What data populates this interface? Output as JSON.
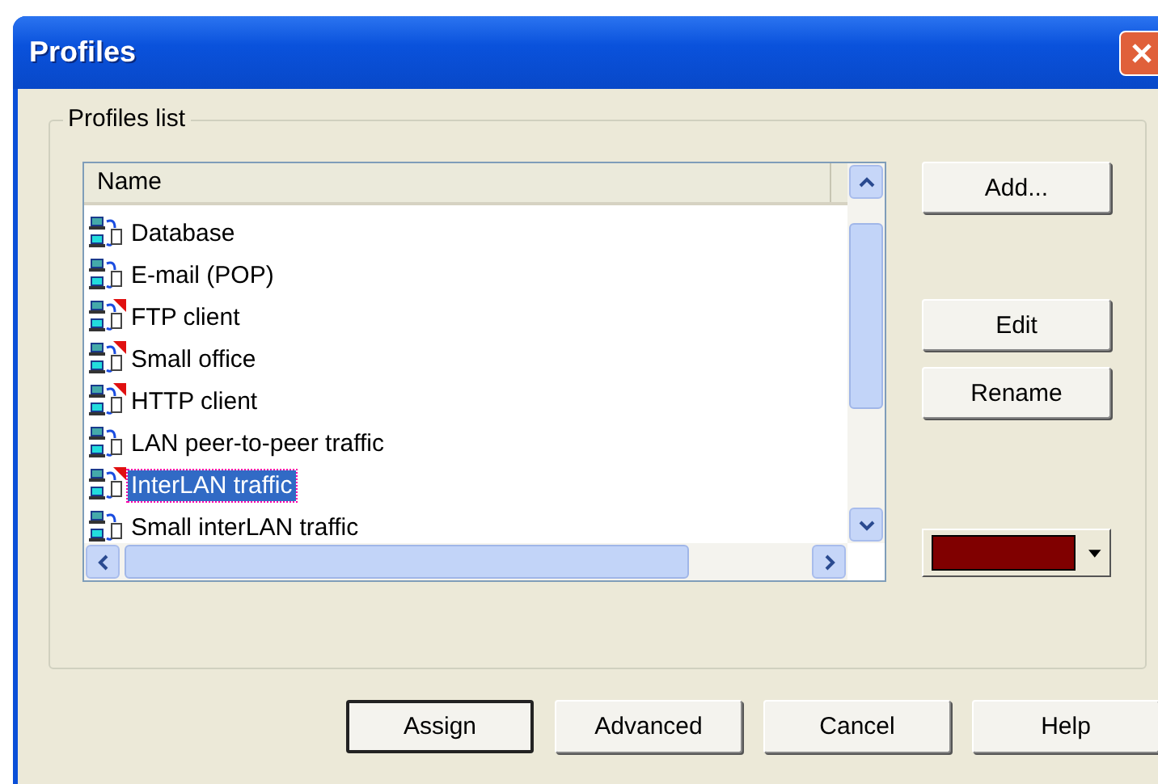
{
  "window": {
    "title": "Profiles"
  },
  "group": {
    "label": "Profiles list"
  },
  "list": {
    "columns": [
      "Name"
    ],
    "rows": [
      {
        "name": "Database",
        "flagged": false,
        "selected": false
      },
      {
        "name": "E-mail (POP)",
        "flagged": false,
        "selected": false
      },
      {
        "name": "FTP client",
        "flagged": true,
        "selected": false
      },
      {
        "name": "Small office",
        "flagged": true,
        "selected": false
      },
      {
        "name": "HTTP client",
        "flagged": true,
        "selected": false
      },
      {
        "name": "LAN peer-to-peer traffic",
        "flagged": false,
        "selected": false
      },
      {
        "name": "InterLAN traffic",
        "flagged": true,
        "selected": true
      },
      {
        "name": "Small interLAN traffic",
        "flagged": false,
        "selected": false
      }
    ]
  },
  "side_buttons": [
    "Add...",
    "Edit",
    "Rename"
  ],
  "color_picker": {
    "color": "#800000"
  },
  "buttons": [
    {
      "label": "Assign",
      "default": true
    },
    {
      "label": "Advanced",
      "default": false
    },
    {
      "label": "Cancel",
      "default": false
    },
    {
      "label": "Help",
      "default": false
    }
  ]
}
